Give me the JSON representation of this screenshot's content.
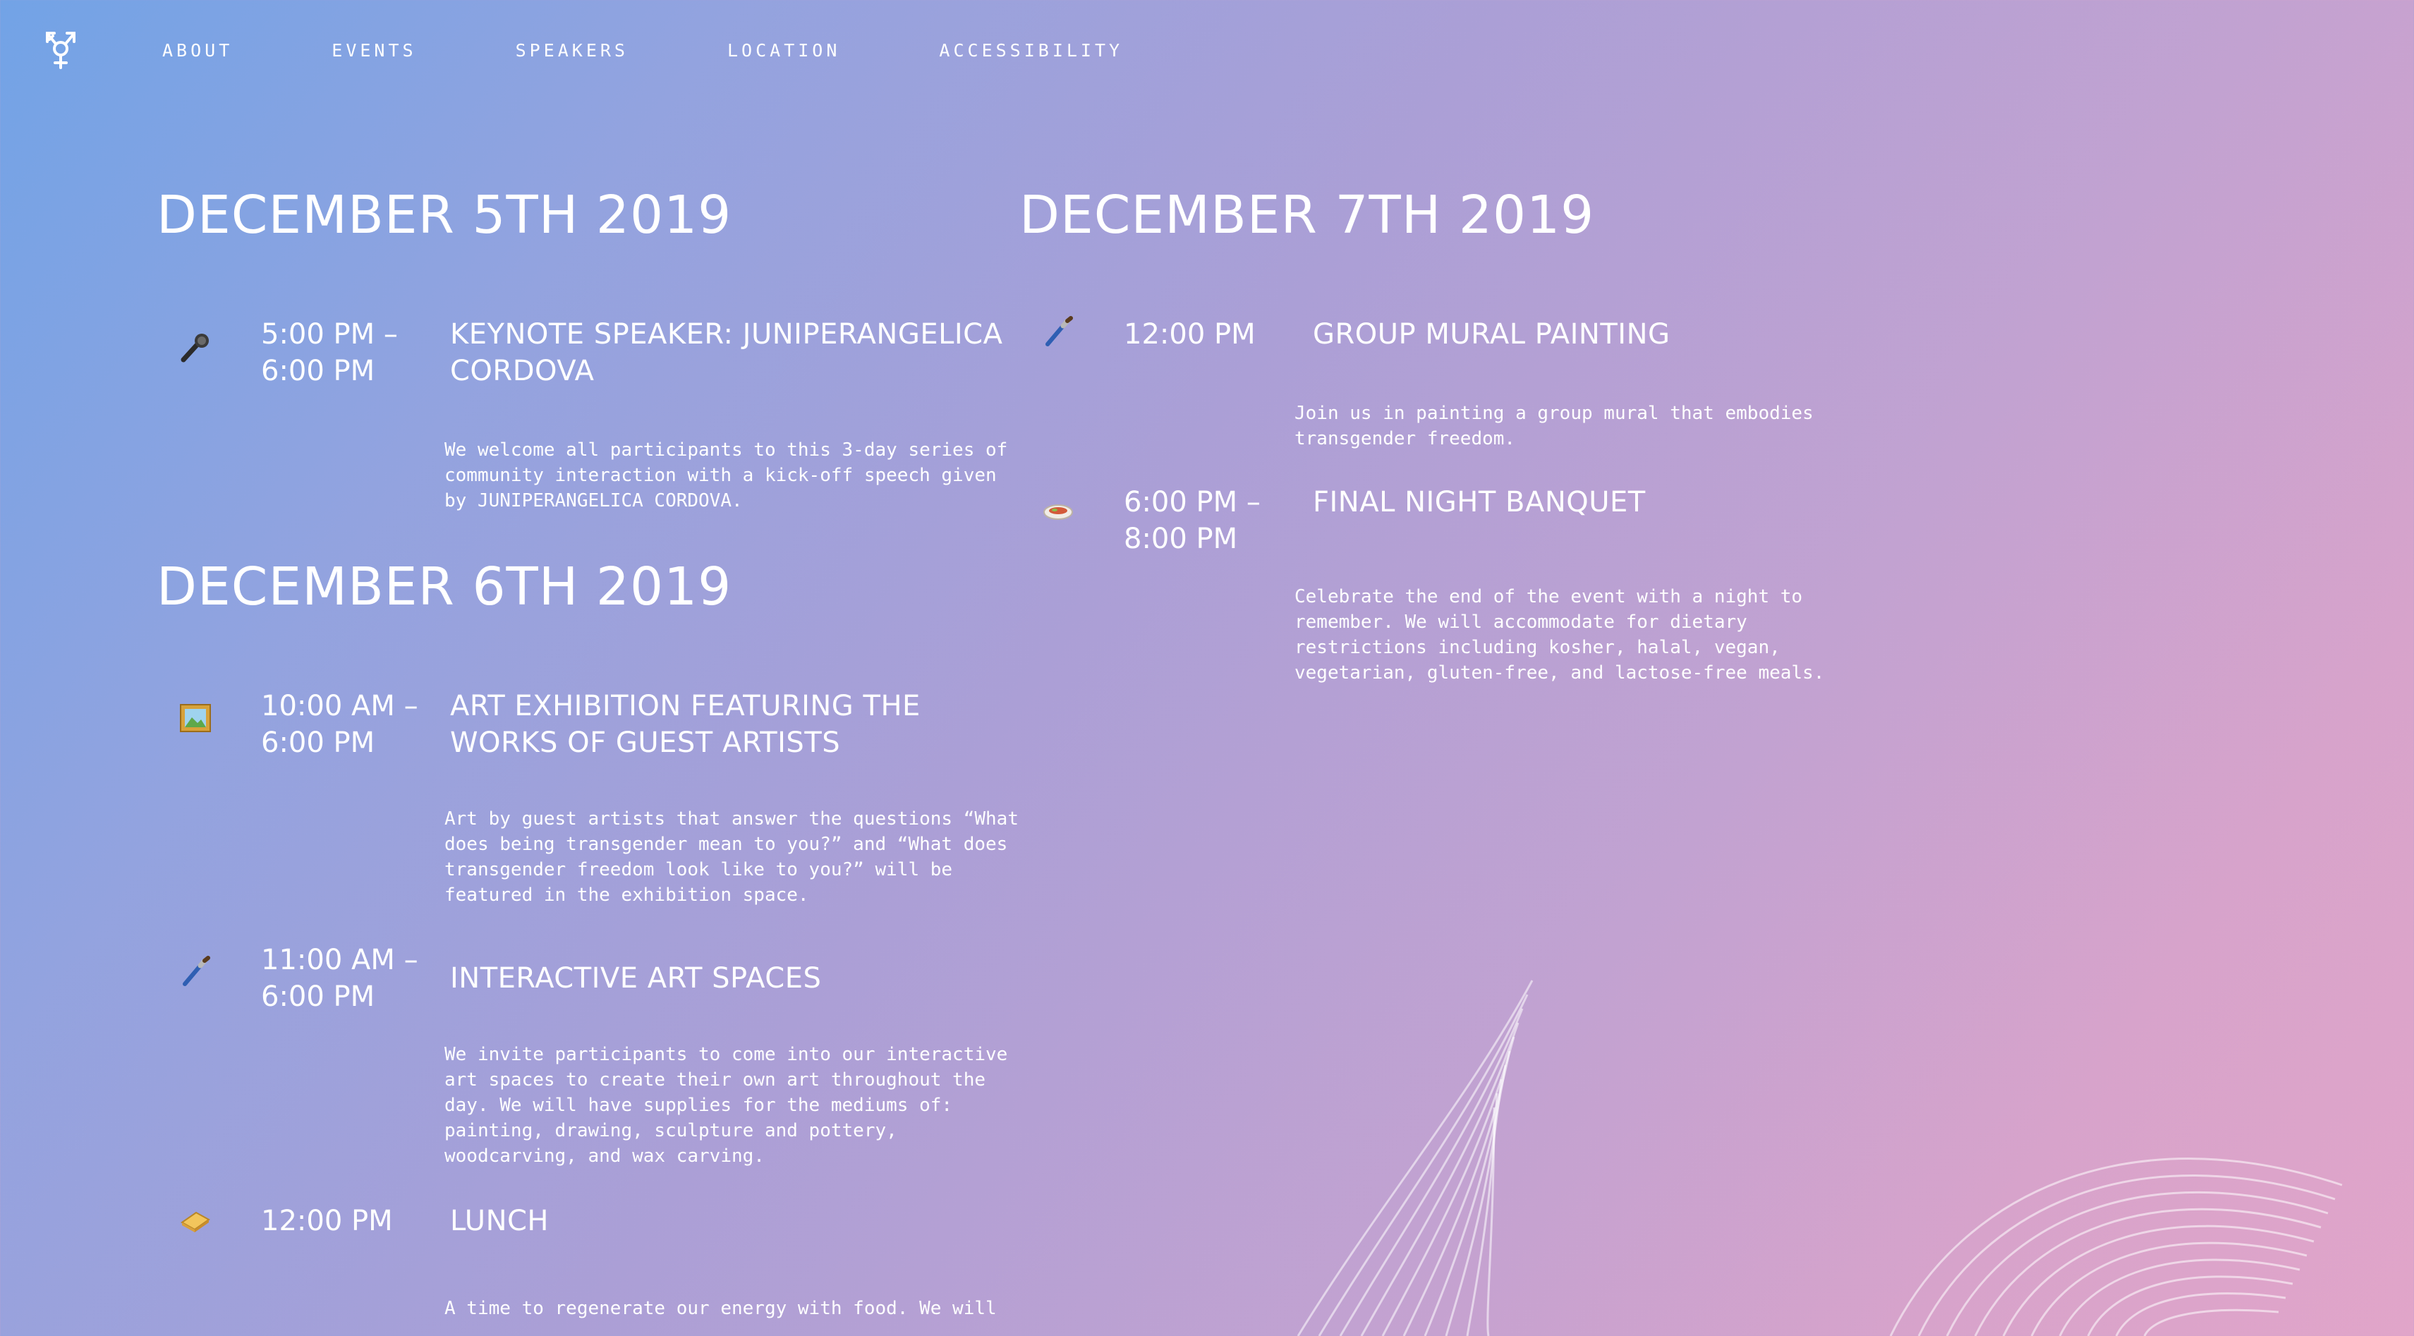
{
  "nav": {
    "logo_icon": "transgender-symbol-icon",
    "links": [
      "ABOUT",
      "EVENTS",
      "SPEAKERS",
      "LOCATION",
      "ACCESSIBILITY"
    ]
  },
  "days": [
    {
      "title": "DECEMBER 5TH 2019",
      "events": [
        {
          "icon": "microphone-icon",
          "time": "5:00 PM – 6:00 PM",
          "title": "KEYNOTE SPEAKER: JUNIPERANGELICA CORDOVA",
          "description": "We welcome all participants to this 3-day series of community interaction with a kick-off speech given by JUNIPERANGELICA CORDOVA."
        }
      ]
    },
    {
      "title": "DECEMBER 6TH 2019",
      "events": [
        {
          "icon": "framed-picture-icon",
          "time": "10:00 AM – 6:00 PM",
          "title": "ART EXHIBITION FEATURING THE WORKS OF GUEST ARTISTS",
          "description": "Art by guest artists that answer the questions “What does being transgender mean to you?” and “What does transgender freedom look like to you?” will be featured in the exhibition space."
        },
        {
          "icon": "paintbrush-icon",
          "time": "11:00 AM – 6:00 PM",
          "title": "INTERACTIVE ART SPACES",
          "description": "We invite participants to come into our interactive art spaces to create their own art throughout the day. We will have supplies for the mediums of: painting, drawing, sculpture and pottery, woodcarving, and wax carving."
        },
        {
          "icon": "sandwich-icon",
          "time": "12:00 PM",
          "title": "LUNCH",
          "description": "A time to regenerate our energy with food. We will"
        }
      ]
    },
    {
      "title": "DECEMBER 7TH 2019",
      "events": [
        {
          "icon": "paintbrush-icon",
          "time": "12:00 PM",
          "title": "GROUP MURAL PAINTING",
          "description": "Join us in painting a group mural that embodies transgender freedom."
        },
        {
          "icon": "pot-of-food-icon",
          "time": "6:00 PM – 8:00 PM",
          "title": "FINAL NIGHT BANQUET",
          "description": "Celebrate the end of the event with a night to remember. We will accommodate for dietary restrictions including kosher, halal, vegan, vegetarian, gluten-free, and lactose-free meals."
        }
      ]
    }
  ]
}
